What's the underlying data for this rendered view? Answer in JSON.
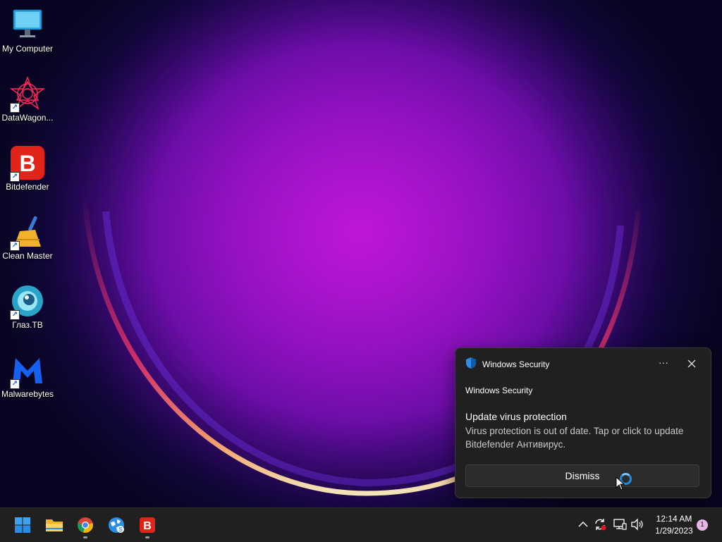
{
  "desktop": {
    "icons": [
      {
        "label": "My Computer",
        "icon": "monitor-icon"
      },
      {
        "label": "DataWagon...",
        "icon": "datawagon-icon"
      },
      {
        "label": "Bitdefender",
        "icon": "bitdefender-icon"
      },
      {
        "label": "Clean Master",
        "icon": "broom-icon"
      },
      {
        "label": "Глаз.ТВ",
        "icon": "eye-tv-icon"
      },
      {
        "label": "Malwarebytes",
        "icon": "malwarebytes-icon"
      }
    ]
  },
  "toast": {
    "app_name": "Windows Security",
    "subtitle": "Windows Security",
    "title": "Update virus protection",
    "body": "Virus protection is out of date. Tap or click to update Bitdefender Антивирус.",
    "more_label": "···",
    "dismiss_label": "Dismiss"
  },
  "taskbar": {
    "apps": [
      {
        "name": "start",
        "icon": "windows-logo-icon"
      },
      {
        "name": "file-explorer",
        "icon": "folder-icon"
      },
      {
        "name": "chrome",
        "icon": "chrome-icon"
      },
      {
        "name": "network-tool",
        "icon": "globe-icon"
      },
      {
        "name": "bitdefender",
        "icon": "bitdefender-icon"
      }
    ],
    "clock": {
      "time": "12:14 AM",
      "date": "1/29/2023"
    },
    "notification_count": "1"
  },
  "colors": {
    "accent": "#0078d4",
    "bitdefender_red": "#e2231a",
    "taskbar_bg": "#202020",
    "toast_bg": "#202020"
  }
}
